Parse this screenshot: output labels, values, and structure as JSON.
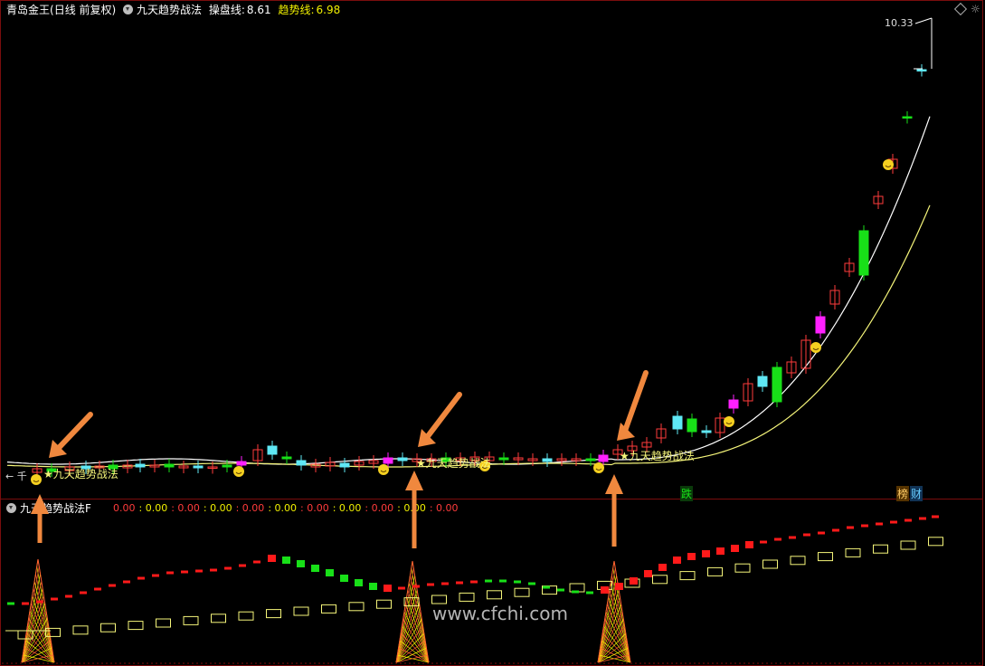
{
  "main_header": {
    "stock_name": "青岛金王",
    "period": "(日线 前复权)",
    "indicator_name": "九天趋势战法",
    "line1_label": "操盘线:",
    "line1_value": "8.61",
    "line2_label": "趋势线:",
    "line2_value": "6.98"
  },
  "sub_header": {
    "indicator_name": "九天趋势战法F",
    "values": [
      "0.00",
      "0.00",
      "0.00",
      "0.00",
      "0.00",
      "0.00",
      "0.00",
      "0.00",
      "0.00",
      "0.00",
      "0.00"
    ]
  },
  "price_label": "10.33",
  "signal_text": "九天趋势战法",
  "left_mark": "← 千",
  "bottom_tags": {
    "die": "跌",
    "bang": "榜",
    "cai": "财"
  },
  "watermark": "www.cfchi.com",
  "colors": {
    "up": "#ff3b3b",
    "down_green": "#18e018",
    "cyan": "#5fe8f5",
    "magenta": "#ff20ff",
    "line_white": "#ffffff",
    "line_yellow": "#f5f57a",
    "arrow": "#f0883e",
    "border": "#7a0d0d",
    "header_yellow": "#f0f000"
  },
  "icons": [
    "smiley-icon",
    "diamond-icon",
    "sun-icon",
    "dropdown-circle-icon",
    "arrow-up-icon",
    "arrow-down-left-icon",
    "tower-icon"
  ],
  "chart_data": {
    "type": "candlestick",
    "ylim": [
      6.5,
      10.5
    ],
    "series_lines": [
      "操盘线",
      "趋势线"
    ]
  }
}
